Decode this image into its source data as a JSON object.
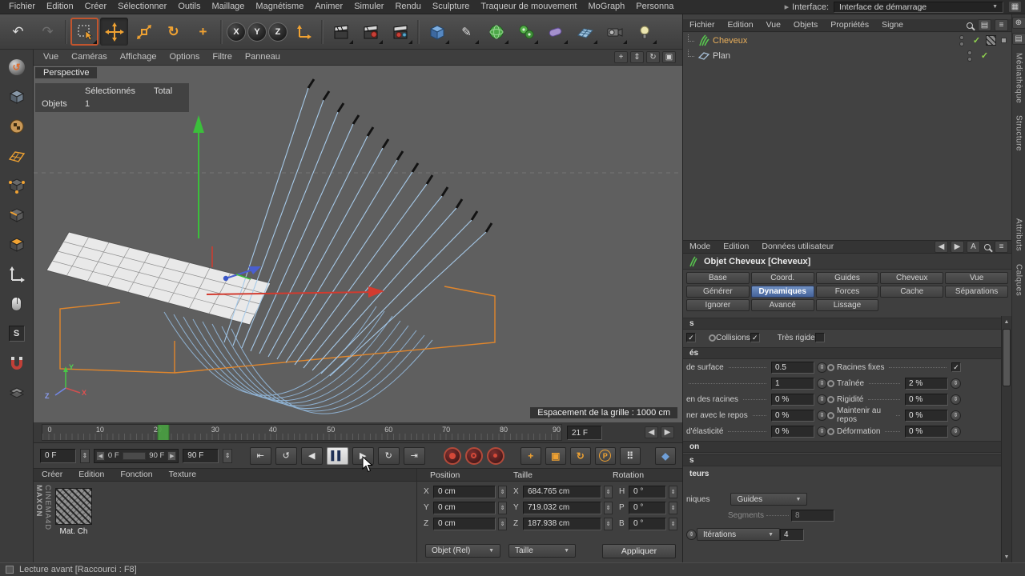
{
  "menubar": {
    "items": [
      "Fichier",
      "Edition",
      "Créer",
      "Sélectionner",
      "Outils",
      "Maillage",
      "Magnétisme",
      "Animer",
      "Simuler",
      "Rendu",
      "Sculpture",
      "Traqueur de mouvement",
      "MoGraph",
      "Personna"
    ],
    "interface_label": "Interface:",
    "interface_value": "Interface de démarrage"
  },
  "toolbar": {
    "axis_locks": [
      "X",
      "Y",
      "Z"
    ]
  },
  "viewport": {
    "menu": [
      "Vue",
      "Caméras",
      "Affichage",
      "Options",
      "Filtre",
      "Panneau"
    ],
    "view_label": "Perspective",
    "hud": {
      "col1": "Sélectionnés",
      "col2": "Total",
      "row_label": "Objets",
      "value": "1"
    },
    "grid_label": "Espacement de la grille : 1000 cm",
    "axis_labels": {
      "x": "X",
      "y": "Y",
      "z": "Z"
    }
  },
  "timeline": {
    "ticks": [
      "0",
      "10",
      "20",
      "30",
      "40",
      "50",
      "60",
      "70",
      "80",
      "90"
    ],
    "frame_field": "21 F"
  },
  "transport": {
    "start_field": "0 F",
    "range_start": "0 F",
    "range_end": "90 F",
    "end_field": "90 F"
  },
  "materials": {
    "menu": [
      "Créer",
      "Edition",
      "Fonction",
      "Texture"
    ],
    "item_name": "Mat. Ch",
    "brand_top": "MAXON",
    "brand_bottom": "CINEMA4D"
  },
  "coords": {
    "headers": [
      "Position",
      "Taille",
      "Rotation"
    ],
    "position": [
      {
        "k": "X",
        "v": "0 cm"
      },
      {
        "k": "Y",
        "v": "0 cm"
      },
      {
        "k": "Z",
        "v": "0 cm"
      }
    ],
    "size": [
      {
        "k": "X",
        "v": "684.765 cm"
      },
      {
        "k": "Y",
        "v": "719.032 cm"
      },
      {
        "k": "Z",
        "v": "187.938 cm"
      }
    ],
    "rotation": [
      {
        "k": "H",
        "v": "0 °"
      },
      {
        "k": "P",
        "v": "0 °"
      },
      {
        "k": "B",
        "v": "0 °"
      }
    ],
    "mode_dropdown": "Objet (Rel)",
    "size_dropdown": "Taille",
    "apply_button": "Appliquer"
  },
  "object_manager": {
    "menu": [
      "Fichier",
      "Edition",
      "Vue",
      "Objets",
      "Propriétés",
      "Signe"
    ],
    "objects": [
      {
        "name": "Cheveux"
      },
      {
        "name": "Plan"
      }
    ]
  },
  "side_tabs": {
    "top": [
      "Médiathèque",
      "Structure"
    ],
    "bottom": [
      "Attributs",
      "Calques"
    ]
  },
  "attributes": {
    "menu": [
      "Mode",
      "Edition",
      "Données utilisateur"
    ],
    "title": "Objet Cheveux [Cheveux]",
    "tabs": [
      [
        "Base",
        "Coord.",
        "Guides",
        "Cheveux",
        "Vue"
      ],
      [
        "Générer",
        "Dynamiques",
        "Forces",
        "Cache",
        "Séparations"
      ],
      [
        "Ignorer",
        "Avancé",
        "Lissage"
      ]
    ],
    "selected_tab": "Dynamiques",
    "sections": {
      "s1": "s",
      "s2": "és",
      "s3": "on",
      "s4": "s",
      "s5": "teurs"
    },
    "rows": {
      "collisions_label": "Collisions",
      "tres_rigide_label": "Très rigide",
      "surface_label": "de surface",
      "surface_value": "0.5",
      "racines_fixes_label": "Racines fixes",
      "blank_value": "1",
      "trainee_label": "Traînée",
      "trainee_value": "2 %",
      "racines_label": "en des racines",
      "racines_value": "0 %",
      "rigidite_label": "Rigidité",
      "rigidite_value": "0 %",
      "repos_label": "ner avec le repos",
      "repos_value": "0 %",
      "maintenir_label": "Maintenir au repos",
      "maintenir_value": "0 %",
      "elasticite_label": "d'élasticité",
      "elasticite_value": "0 %",
      "deformation_label": "Déformation",
      "deformation_value": "0 %",
      "niques_label": "niques",
      "niques_value": "Guides",
      "segments_label": "Segments",
      "segments_value": "8",
      "iterations_label": "Itérations",
      "iterations_value": "4"
    }
  },
  "statusbar": {
    "text": "Lecture avant [Raccourci : F8]"
  },
  "icons": {
    "undo": "↶",
    "redo": "↷",
    "rotate": "↻",
    "plus": "+",
    "scale": "▣",
    "pan": "+",
    "dolly": "⇕",
    "orbit": "↻",
    "toggle_view": "▣",
    "dropdown": "▼",
    "stepper": "⇕",
    "check": "✓",
    "goto_start": "⇤",
    "play_back": "↺",
    "prev_frame": "◀",
    "pause": "▌▌",
    "next_frame": "▶",
    "play": "↻",
    "goto_end": "⇥",
    "tl_left": "◀",
    "tl_right": "▶",
    "range_left": "◀",
    "range_right": "▶",
    "key_param": "P",
    "key_pla": "⠿",
    "key_extra": "◆",
    "back": "◀",
    "forward": "▶",
    "letter_a": "A",
    "menu": "≡",
    "grid_btn": "▤",
    "plus_btn": "⊕",
    "pen": "✎",
    "s_mode": "S",
    "arrow_right": "▸",
    "window": "▦"
  }
}
